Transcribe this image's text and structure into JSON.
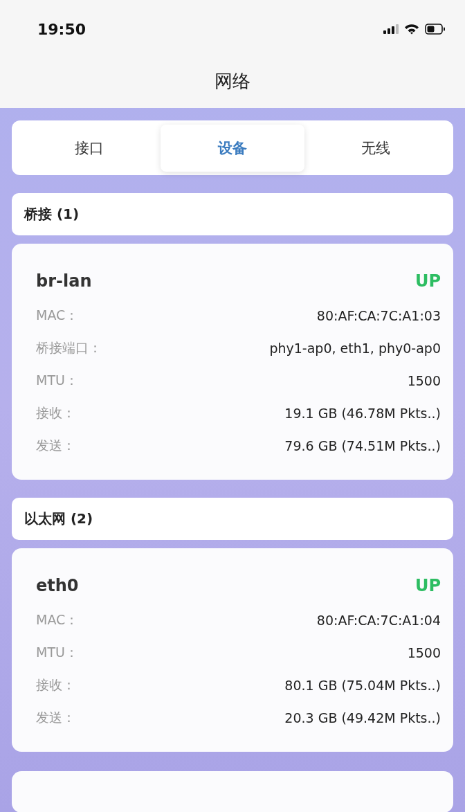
{
  "status_bar": {
    "time": "19:50"
  },
  "header": {
    "title": "网络"
  },
  "tabs": [
    {
      "label": "接口",
      "selected": false
    },
    {
      "label": "设备",
      "selected": true
    },
    {
      "label": "无线",
      "selected": false
    }
  ],
  "sections": [
    {
      "title": "桥接 (1)",
      "devices": [
        {
          "name": "br-lan",
          "status": "UP",
          "up": true,
          "fields": [
            {
              "label": "MAC：",
              "value": "80:AF:CA:7C:A1:03"
            },
            {
              "label": "桥接端口：",
              "value": "phy1-ap0, eth1, phy0-ap0"
            },
            {
              "label": "MTU：",
              "value": "1500"
            },
            {
              "label": "接收：",
              "value": "19.1 GB (46.78M Pkts..)"
            },
            {
              "label": "发送：",
              "value": "79.6 GB (74.51M Pkts..)"
            }
          ]
        }
      ]
    },
    {
      "title": "以太网 (2)",
      "devices": [
        {
          "name": "eth0",
          "status": "UP",
          "up": true,
          "fields": [
            {
              "label": "MAC：",
              "value": "80:AF:CA:7C:A1:04"
            },
            {
              "label": "MTU：",
              "value": "1500"
            },
            {
              "label": "接收：",
              "value": "80.1 GB (75.04M Pkts..)"
            },
            {
              "label": "发送：",
              "value": "20.3 GB (49.42M Pkts..)"
            }
          ]
        }
      ]
    }
  ]
}
